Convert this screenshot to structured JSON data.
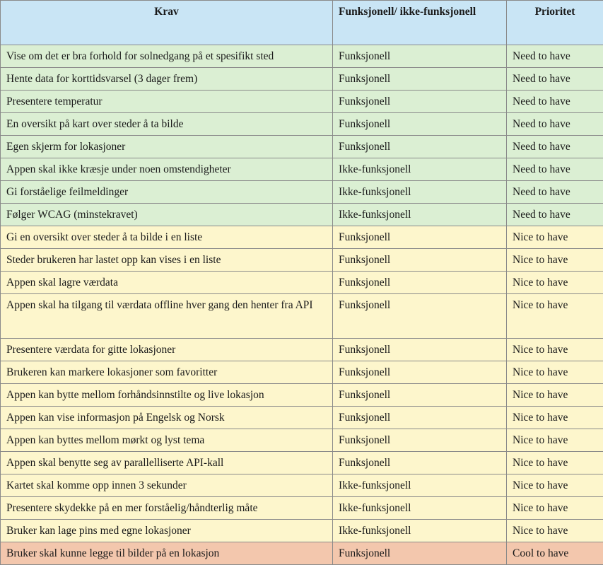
{
  "colors": {
    "header": "#c9e5f5",
    "need_to_have": "#dbefd3",
    "nice_to_have": "#fdf6cc",
    "cool_to_have": "#f3c7ad",
    "border": "#8a8a8a"
  },
  "headers": {
    "krav": "Krav",
    "type": "Funksjonell/ ikke-funksjonell",
    "prioritet": "Prioritet"
  },
  "rows": [
    {
      "krav": "Vise om det er bra forhold for solnedgang på et spesifikt sted",
      "type": "Funksjonell",
      "prioritet": "Need to have"
    },
    {
      "krav": "Hente data for korttidsvarsel (3 dager frem)",
      "type": "Funksjonell",
      "prioritet": "Need to have"
    },
    {
      "krav": "Presentere temperatur",
      "type": "Funksjonell",
      "prioritet": "Need to have"
    },
    {
      "krav": "En oversikt på kart over steder å ta bilde",
      "type": "Funksjonell",
      "prioritet": "Need to have"
    },
    {
      "krav": "Egen skjerm for lokasjoner",
      "type": "Funksjonell",
      "prioritet": "Need to have"
    },
    {
      "krav": "Appen skal ikke kræsje under noen omstendigheter",
      "type": "Ikke-funksjonell",
      "prioritet": "Need to have"
    },
    {
      "krav": "Gi forståelige feilmeldinger",
      "type": "Ikke-funksjonell",
      "prioritet": "Need to have"
    },
    {
      "krav": "Følger WCAG (minstekravet)",
      "type": "Ikke-funksjonell",
      "prioritet": "Need to have"
    },
    {
      "krav": "Gi en oversikt over steder å ta bilde i en liste",
      "type": "Funksjonell",
      "prioritet": "Nice to have"
    },
    {
      "krav": "Steder brukeren har lastet opp kan vises i en liste",
      "type": "Funksjonell",
      "prioritet": "Nice to have"
    },
    {
      "krav": "Appen skal lagre værdata",
      "type": "Funksjonell",
      "prioritet": "Nice to have"
    },
    {
      "krav": "Appen skal ha tilgang til værdata offline hver gang den henter fra API",
      "type": "Funksjonell",
      "prioritet": "Nice to have"
    },
    {
      "krav": "Presentere værdata for gitte lokasjoner",
      "type": "Funksjonell",
      "prioritet": "Nice to have"
    },
    {
      "krav": "Brukeren kan markere lokasjoner som favoritter",
      "type": "Funksjonell",
      "prioritet": "Nice to have"
    },
    {
      "krav": "Appen kan bytte mellom forhåndsinnstilte og live lokasjon",
      "type": "Funksjonell",
      "prioritet": "Nice to have"
    },
    {
      "krav": "Appen kan vise informasjon på Engelsk og Norsk",
      "type": "Funksjonell",
      "prioritet": "Nice to have"
    },
    {
      "krav": "Appen kan byttes mellom mørkt og lyst tema",
      "type": "Funksjonell",
      "prioritet": "Nice to have"
    },
    {
      "krav": "Appen skal benytte seg av parallelliserte API-kall",
      "type": "Funksjonell",
      "prioritet": "Nice to have"
    },
    {
      "krav": "Kartet skal komme opp innen 3 sekunder",
      "type": "Ikke-funksjonell",
      "prioritet": "Nice to have"
    },
    {
      "krav": "Presentere skydekke på en mer forståelig/håndterlig måte",
      "type": "Ikke-funksjonell",
      "prioritet": "Nice to have"
    },
    {
      "krav": "Bruker kan lage pins med egne lokasjoner",
      "type": "Ikke-funksjonell",
      "prioritet": "Nice to have"
    },
    {
      "krav": "Bruker skal kunne legge til bilder på en lokasjon",
      "type": "Funksjonell",
      "prioritet": "Cool to have"
    }
  ]
}
